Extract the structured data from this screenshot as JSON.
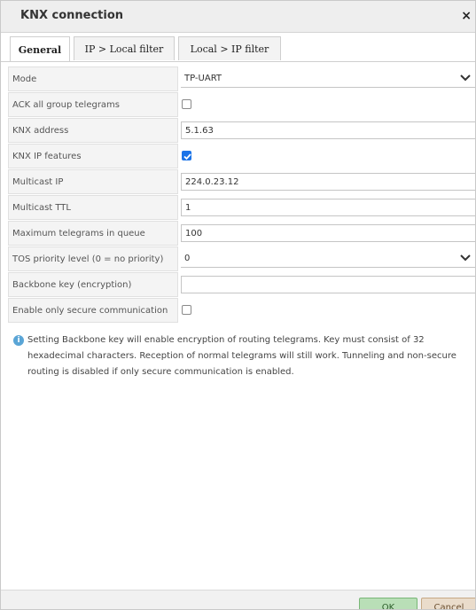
{
  "dialog": {
    "title": "KNX connection",
    "close_glyph": "×"
  },
  "tabs": [
    {
      "label": "General",
      "active": true
    },
    {
      "label": "IP > Local filter",
      "active": false
    },
    {
      "label": "Local > IP filter",
      "active": false
    }
  ],
  "fields": {
    "mode": {
      "label": "Mode",
      "value": "TP-UART"
    },
    "ack_all": {
      "label": "ACK all group telegrams",
      "checked": false
    },
    "knx_address": {
      "label": "KNX address",
      "value": "5.1.63"
    },
    "knx_ip_features": {
      "label": "KNX IP features",
      "checked": true
    },
    "multicast_ip": {
      "label": "Multicast IP",
      "value": "224.0.23.12"
    },
    "multicast_ttl": {
      "label": "Multicast TTL",
      "value": "1"
    },
    "max_queue": {
      "label": "Maximum telegrams in queue",
      "value": "100"
    },
    "tos_priority": {
      "label": "TOS priority level (0 = no priority)",
      "value": "0"
    },
    "backbone_key": {
      "label": "Backbone key (encryption)",
      "value": ""
    },
    "secure_only": {
      "label": "Enable only secure communication",
      "checked": false
    }
  },
  "info": {
    "icon": "info-icon",
    "text": "Setting Backbone key will enable encryption of routing telegrams. Key must consist of 32 hexadecimal characters. Reception of normal telegrams will still work. Tunneling and non-secure routing is disabled if only secure communication is enabled."
  },
  "footer": {
    "ok_label": "OK",
    "cancel_label": "Cancel"
  },
  "colors": {
    "checkbox_checked": "#1a73e8",
    "ok_bg": "#b9dfb7",
    "cancel_bg": "#eadccb",
    "info_icon": "#5aa5d6"
  }
}
